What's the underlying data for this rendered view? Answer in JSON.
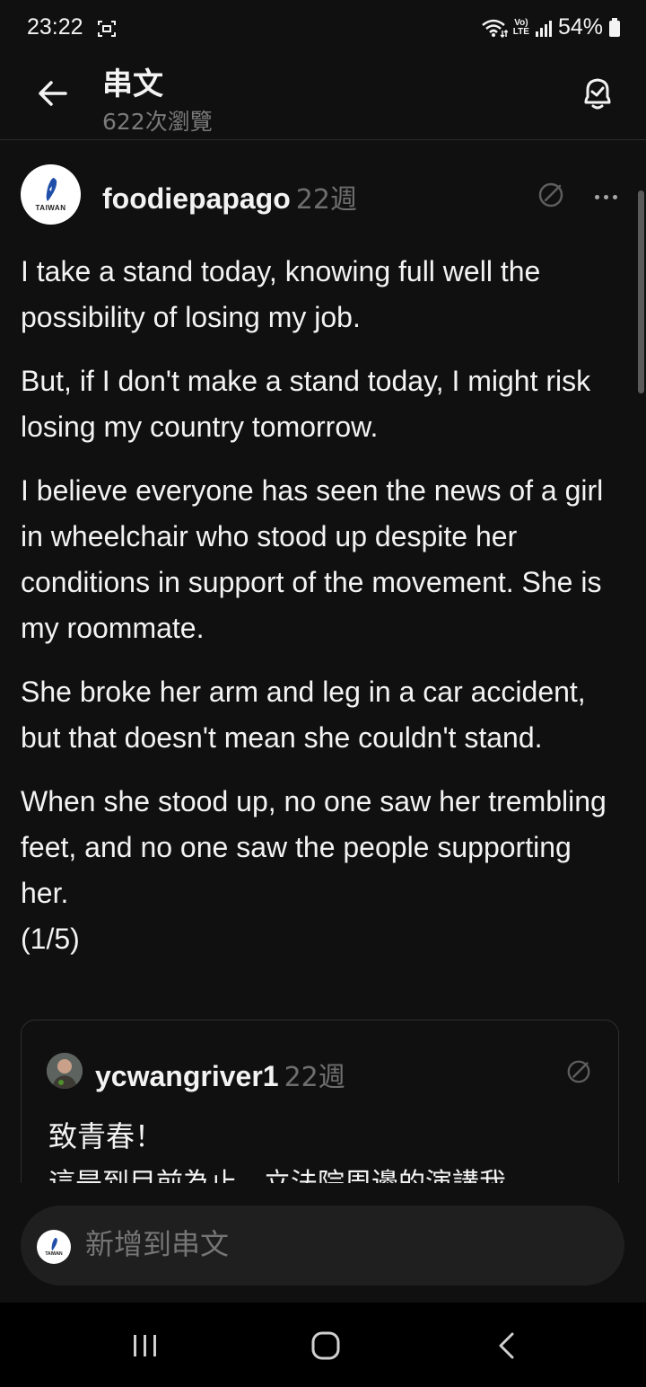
{
  "status_bar": {
    "time": "23:22",
    "network_top": "Vo)",
    "network_bottom": "LTE",
    "battery": "54%"
  },
  "header": {
    "title": "串文",
    "subtitle": "622次瀏覽"
  },
  "post": {
    "username": "foodiepapago",
    "time": "22週",
    "avatar_label": "TAIWAN",
    "paragraphs": [
      "I take a stand today, knowing full well the possibility of losing my job.",
      "But, if I don't make a stand today, I might risk losing my country tomorrow.",
      "I believe everyone has seen the news of a girl in wheelchair who stood up despite her conditions in support of the movement. She is my roommate.",
      "She broke her arm and leg in a car accident, but that doesn't mean she couldn't stand.",
      "When she stood up, no one saw her trembling feet, and no one saw the people supporting her.",
      "(1/5)"
    ]
  },
  "quote": {
    "username": "ycwangriver1",
    "time": "22週",
    "line1": "致青春！",
    "line2": "這是到目前為止，立法院周邊的演講我"
  },
  "reply": {
    "placeholder": "新增到串文",
    "avatar_label": "TAIWAN"
  },
  "colors": {
    "background": "#101010",
    "text": "#f3f3f3",
    "muted": "#6e6e6e"
  }
}
